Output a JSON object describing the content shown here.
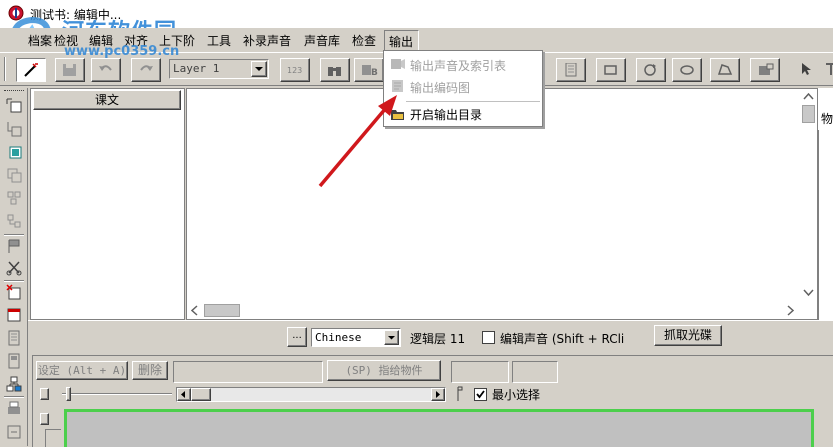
{
  "window": {
    "title": "测试书: 编辑中..."
  },
  "watermark": {
    "text": "河东软件园",
    "url": "www.pc0359.cn"
  },
  "menubar": {
    "items": [
      "档案",
      "检视",
      "编辑",
      "对齐",
      "上下阶",
      "工具",
      "补录声音",
      "声音库",
      "检查",
      "输出"
    ]
  },
  "toolbar": {
    "layer_value": "Layer 1"
  },
  "output_menu": {
    "items": [
      {
        "label": "输出声音及索引表",
        "enabled": false
      },
      {
        "label": "输出编码图",
        "enabled": false
      },
      {
        "label": "开启输出目录",
        "enabled": true
      }
    ]
  },
  "lesson_panel": {
    "header": "课文"
  },
  "right_panel": {
    "partial_label": "物"
  },
  "controls_row": {
    "ellipsis_label": "...",
    "language_value": "Chinese",
    "logic_layer_label": "逻辑层 11",
    "edit_sound_label": "编辑声音 (Shift + RCli",
    "capture_disc_label": "抓取光碟"
  },
  "settings_row": {
    "set_label": "设定 (Alt + A)",
    "delete_label": "删除",
    "assign_label": "(SP) 指给物件"
  },
  "slider_row": {
    "min_select_label": "最小选择",
    "min_select_checked": true
  },
  "colors": {
    "accent_green": "#4ccf4c",
    "arrow_red": "#d0181c"
  }
}
